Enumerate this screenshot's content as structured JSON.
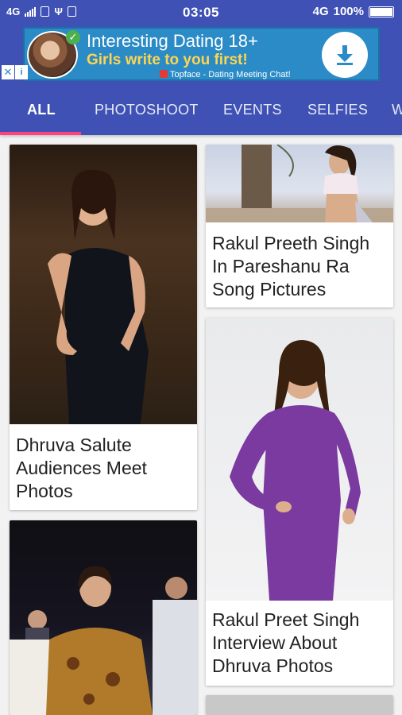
{
  "status_bar": {
    "network_left": "4G",
    "time": "03:05",
    "network_right": "4G",
    "battery": "100%"
  },
  "ad": {
    "title": "Interesting Dating 18+",
    "subtitle": "Girls write to you first!",
    "small_text": "Topface - Dating Meeting Chat!",
    "close_icon": "close-icon",
    "info_icon": "info-icon",
    "download_icon": "download-icon",
    "colors": {
      "background": "#2b8bc6",
      "subtitle": "#ffd54f"
    }
  },
  "tabs": [
    {
      "label": "ALL",
      "active": true
    },
    {
      "label": "PHOTOSHOOT",
      "active": false
    },
    {
      "label": "EVENTS",
      "active": false
    },
    {
      "label": "SELFIES",
      "active": false
    },
    {
      "label": "W",
      "active": false
    }
  ],
  "theme": {
    "primary": "#3f51b5",
    "accent": "#ff4081"
  },
  "gallery": {
    "left": [
      {
        "title": "Dhruva Salute Audiences Meet Photos"
      },
      {
        "title": ""
      }
    ],
    "right": [
      {
        "title": "Rakul Preeth Singh In Pareshanu Ra Song Pictures"
      },
      {
        "title": "Rakul Preet Singh Interview About Dhruva Photos"
      },
      {
        "title": ""
      }
    ]
  }
}
